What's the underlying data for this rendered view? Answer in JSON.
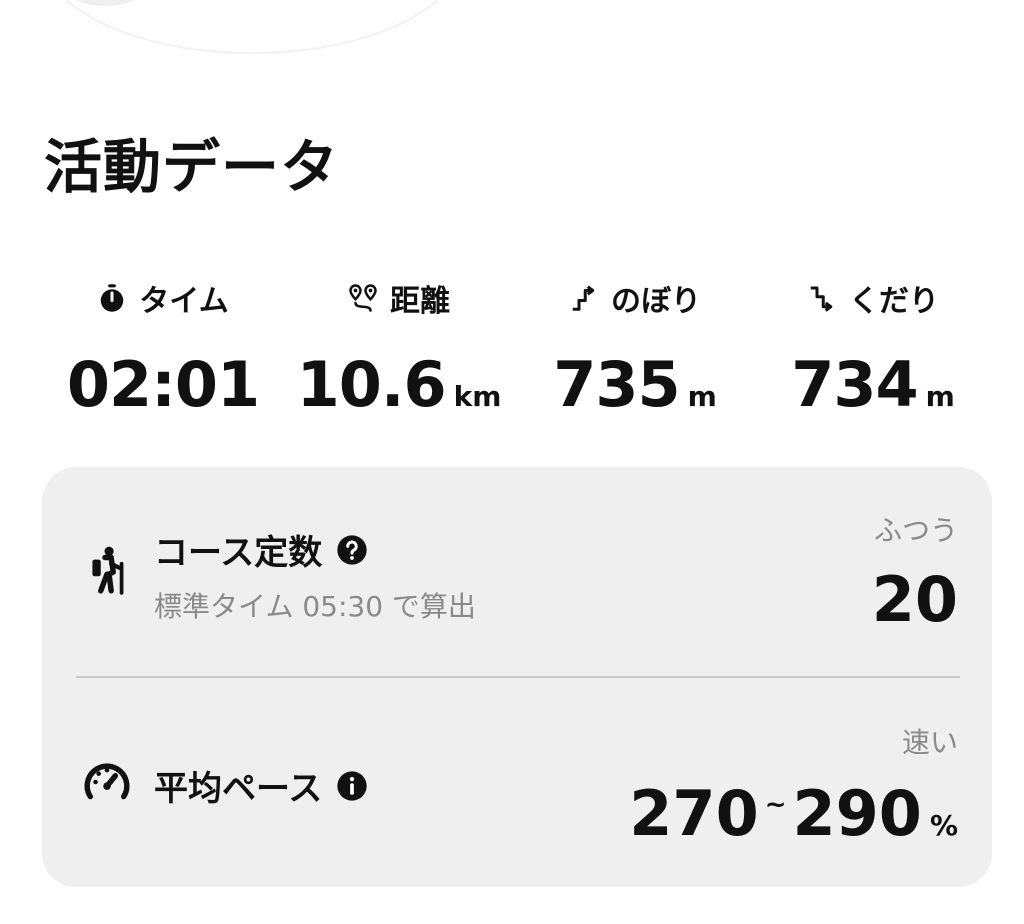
{
  "section_title": "活動データ",
  "stats": [
    {
      "label": "タイム",
      "icon": "stopwatch-icon",
      "value": "02:01",
      "unit": ""
    },
    {
      "label": "距離",
      "icon": "route-pins-icon",
      "value": "10.6",
      "unit": "km"
    },
    {
      "label": "のぼり",
      "icon": "ascent-icon",
      "value": "735",
      "unit": "m"
    },
    {
      "label": "くだり",
      "icon": "descent-icon",
      "value": "734",
      "unit": "m"
    }
  ],
  "course_constant": {
    "title": "コース定数",
    "icon": "hiker-icon",
    "help_icon": "question-circle-icon",
    "subtitle": "標準タイム 05:30 で算出",
    "grade": "ふつう",
    "value": "20"
  },
  "average_pace": {
    "title": "平均ペース",
    "icon": "speedometer-icon",
    "info_icon": "info-circle-icon",
    "grade": "速い",
    "min": "270",
    "separator": "~",
    "max": "290",
    "unit": "%"
  }
}
